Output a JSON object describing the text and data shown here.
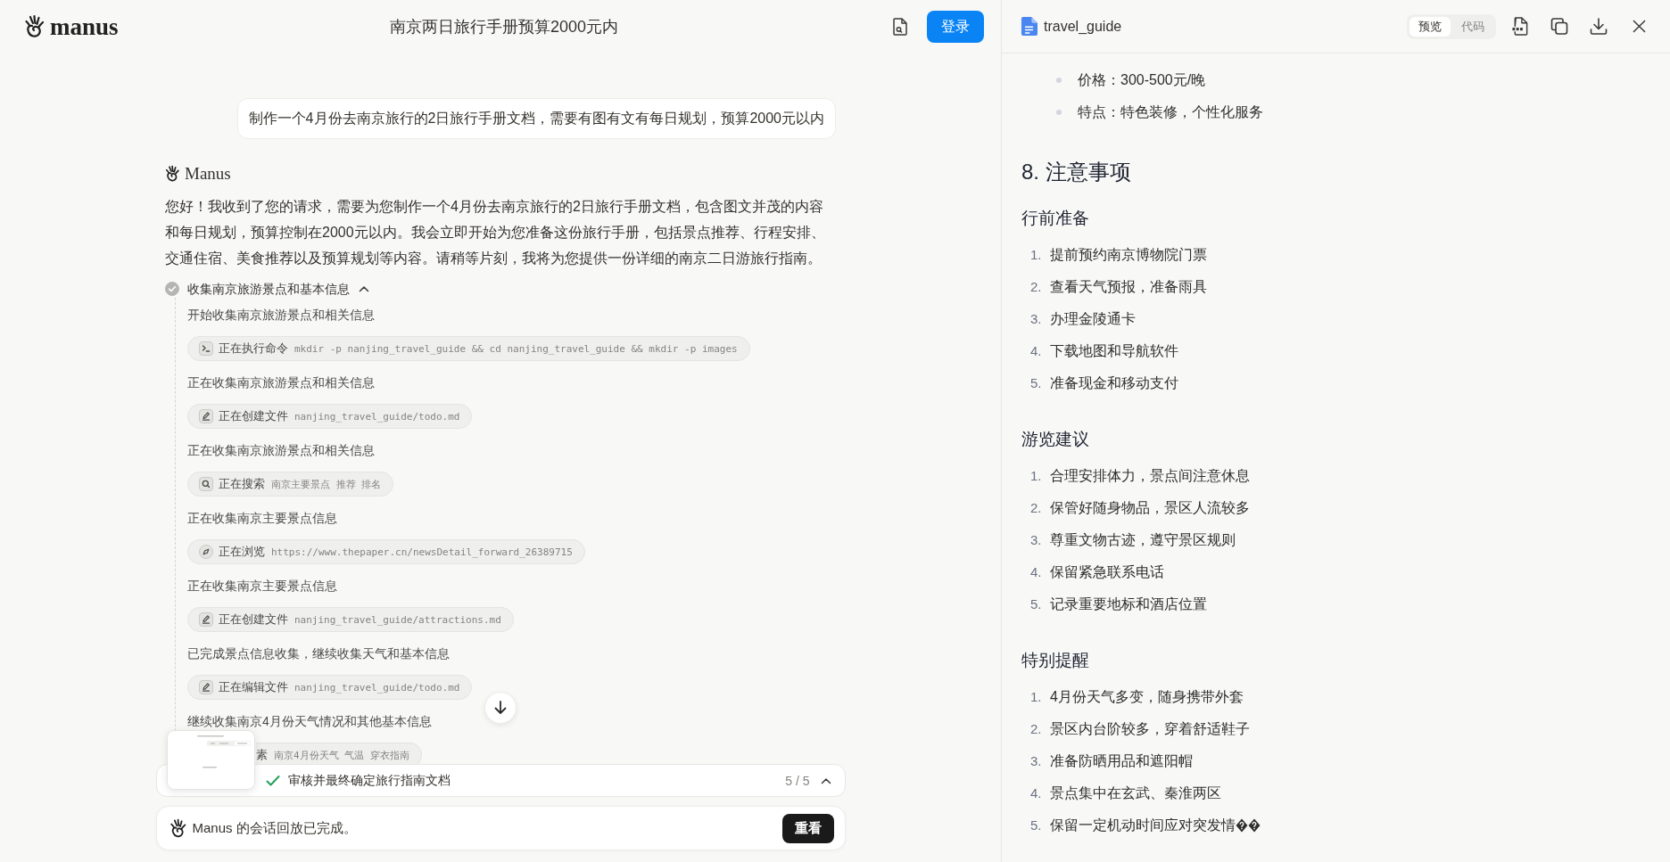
{
  "header": {
    "logo_text": "manus",
    "title": "南京两日旅行手册预算2000元内",
    "login_button": "登录"
  },
  "chat": {
    "user_message": "制作一个4月份去南京旅行的2日旅行手册文档，需要有图有文有每日规划，预算2000元以内",
    "assistant_name": "Manus",
    "assistant_message": "您好！我收到了您的请求，需要为您制作一个4月份去南京旅行的2日旅行手册文档，包含图文并茂的内容和每日规划，预算控制在2000元以内。我会立即开始为您准备这份旅行手册，包括景点推荐、行程安排、交通住宿、美食推荐以及预算规划等内容。请稍等片刻，我将为您提供一份详细的南京二日游旅行指南。",
    "task": {
      "title": "收集南京旅游景点和基本信息",
      "done": true,
      "expanded": true,
      "steps": [
        {
          "text": "开始收集南京旅游景点和相关信息",
          "tool": {
            "kind": "terminal",
            "label": "正在执行命令",
            "argument": "mkdir -p nanjing_travel_guide && cd nanjing_travel_guide && mkdir -p images"
          }
        },
        {
          "text": "正在收集南京旅游景点和相关信息",
          "tool": {
            "kind": "edit",
            "label": "正在创建文件",
            "argument": "nanjing_travel_guide/todo.md"
          }
        },
        {
          "text": "正在收集南京旅游景点和相关信息",
          "tool": {
            "kind": "search",
            "label": "正在搜索",
            "argument": "南京主要景点 推荐 排名"
          }
        },
        {
          "text": "正在收集南京主要景点信息",
          "tool": {
            "kind": "browse",
            "label": "正在浏览",
            "argument": "https://www.thepaper.cn/newsDetail_forward_26389715"
          }
        },
        {
          "text": "正在收集南京主要景点信息",
          "tool": {
            "kind": "edit",
            "label": "正在创建文件",
            "argument": "nanjing_travel_guide/attractions.md"
          }
        },
        {
          "text": "已完成景点信息收集，继续收集天气和基本信息",
          "tool": {
            "kind": "edit",
            "label": "正在编辑文件",
            "argument": "nanjing_travel_guide/todo.md"
          }
        },
        {
          "text": "继续收集南京4月份天气情况和其他基本信息",
          "tool": {
            "kind": "covered",
            "label": "素",
            "argument": "南京4月份天气 气温 穿衣指南"
          }
        }
      ]
    }
  },
  "plan_bar": {
    "done": true,
    "current_step": "审核并最终确定旅行指南文档",
    "count": "5 / 5"
  },
  "replay_bar": {
    "message": "Manus 的会话回放已完成。",
    "replay_button": "重看"
  },
  "document": {
    "filename": "travel_guide",
    "view_tabs": [
      {
        "label": "预览",
        "selected": true
      },
      {
        "label": "代码",
        "selected": false
      }
    ],
    "blocks": [
      {
        "kind": "bullets",
        "items": [
          "价格：300-500元/晚",
          "特点：特色装修，个性化服务"
        ]
      },
      {
        "kind": "h2",
        "text": "8. 注意事项"
      },
      {
        "kind": "h3",
        "text": "行前准备"
      },
      {
        "kind": "numbered",
        "items": [
          {
            "number": "1.",
            "text": "提前预约南京博物院门票",
            "garbled_tail": false
          },
          {
            "number": "2.",
            "text": "查看天气预报，准备雨具",
            "garbled_tail": false
          },
          {
            "number": "3.",
            "text": "办理金陵通卡",
            "garbled_tail": false
          },
          {
            "number": "4.",
            "text": "下载地图和导航软件",
            "garbled_tail": false
          },
          {
            "number": "5.",
            "text": "准备现金和移动支付",
            "garbled_tail": false
          }
        ]
      },
      {
        "kind": "h3",
        "text": "游览建议"
      },
      {
        "kind": "numbered",
        "items": [
          {
            "number": "1.",
            "text": "合理安排体力，景点间注意休息",
            "garbled_tail": false
          },
          {
            "number": "2.",
            "text": "保管好随身物品，景区人流较多",
            "garbled_tail": false
          },
          {
            "number": "3.",
            "text": "尊重文物古迹，遵守景区规则",
            "garbled_tail": false
          },
          {
            "number": "4.",
            "text": "保留紧急联系电话",
            "garbled_tail": false
          },
          {
            "number": "5.",
            "text": "记录重要地标和酒店位置",
            "garbled_tail": false
          }
        ]
      },
      {
        "kind": "h3",
        "text": "特别提醒"
      },
      {
        "kind": "numbered",
        "items": [
          {
            "number": "1.",
            "text": "4月份天气多变，随身携带外套",
            "garbled_tail": false
          },
          {
            "number": "2.",
            "text": "景区内台阶较多，穿着舒适鞋子",
            "garbled_tail": false
          },
          {
            "number": "3.",
            "text": "准备防晒用品和遮阳帽",
            "garbled_tail": false
          },
          {
            "number": "4.",
            "text": "景点集中在玄武、秦淮两区",
            "garbled_tail": false
          },
          {
            "number": "5.",
            "text": "保留一定机动时间应对突发情",
            "garbled_tail": true
          }
        ]
      }
    ]
  }
}
